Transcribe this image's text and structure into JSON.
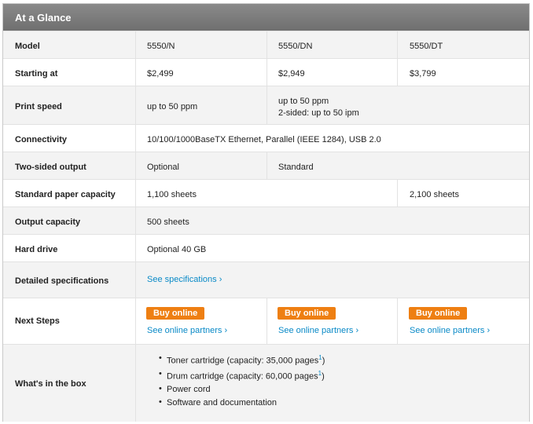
{
  "header": {
    "title": "At a Glance"
  },
  "rows": {
    "model": {
      "label": "Model",
      "values": [
        "5550/N",
        "5550/DN",
        "5550/DT"
      ]
    },
    "price": {
      "label": "Starting at",
      "values": [
        "$2,499",
        "$2,949",
        "$3,799"
      ]
    },
    "speed": {
      "label": "Print speed",
      "values": [
        "up to 50 ppm",
        "up to 50 ppm",
        "2-sided: up to 50 ipm"
      ]
    },
    "connectivity": {
      "label": "Connectivity",
      "value": "10/100/1000BaseTX Ethernet, Parallel (IEEE 1284), USB 2.0"
    },
    "two_sided": {
      "label": "Two-sided output",
      "values": [
        "Optional",
        "Standard"
      ]
    },
    "paper": {
      "label": "Standard paper capacity",
      "values": [
        "1,100 sheets",
        "2,100 sheets"
      ]
    },
    "output": {
      "label": "Output capacity",
      "value": "500 sheets"
    },
    "hard_drive": {
      "label": "Hard drive",
      "value": "Optional 40 GB"
    },
    "specs": {
      "label": "Detailed specifications",
      "link": "See specifications ›"
    },
    "next_steps": {
      "label": "Next Steps",
      "buy_label": "Buy online",
      "partners_link": "See online partners ›"
    },
    "box": {
      "label": "What's in the box",
      "items": [
        "Toner cartridge (capacity: 35,000 pages",
        "Drum cartridge (capacity: 60,000 pages",
        "Power cord",
        "Software and documentation"
      ],
      "footnote": "1",
      "close": ")"
    }
  }
}
